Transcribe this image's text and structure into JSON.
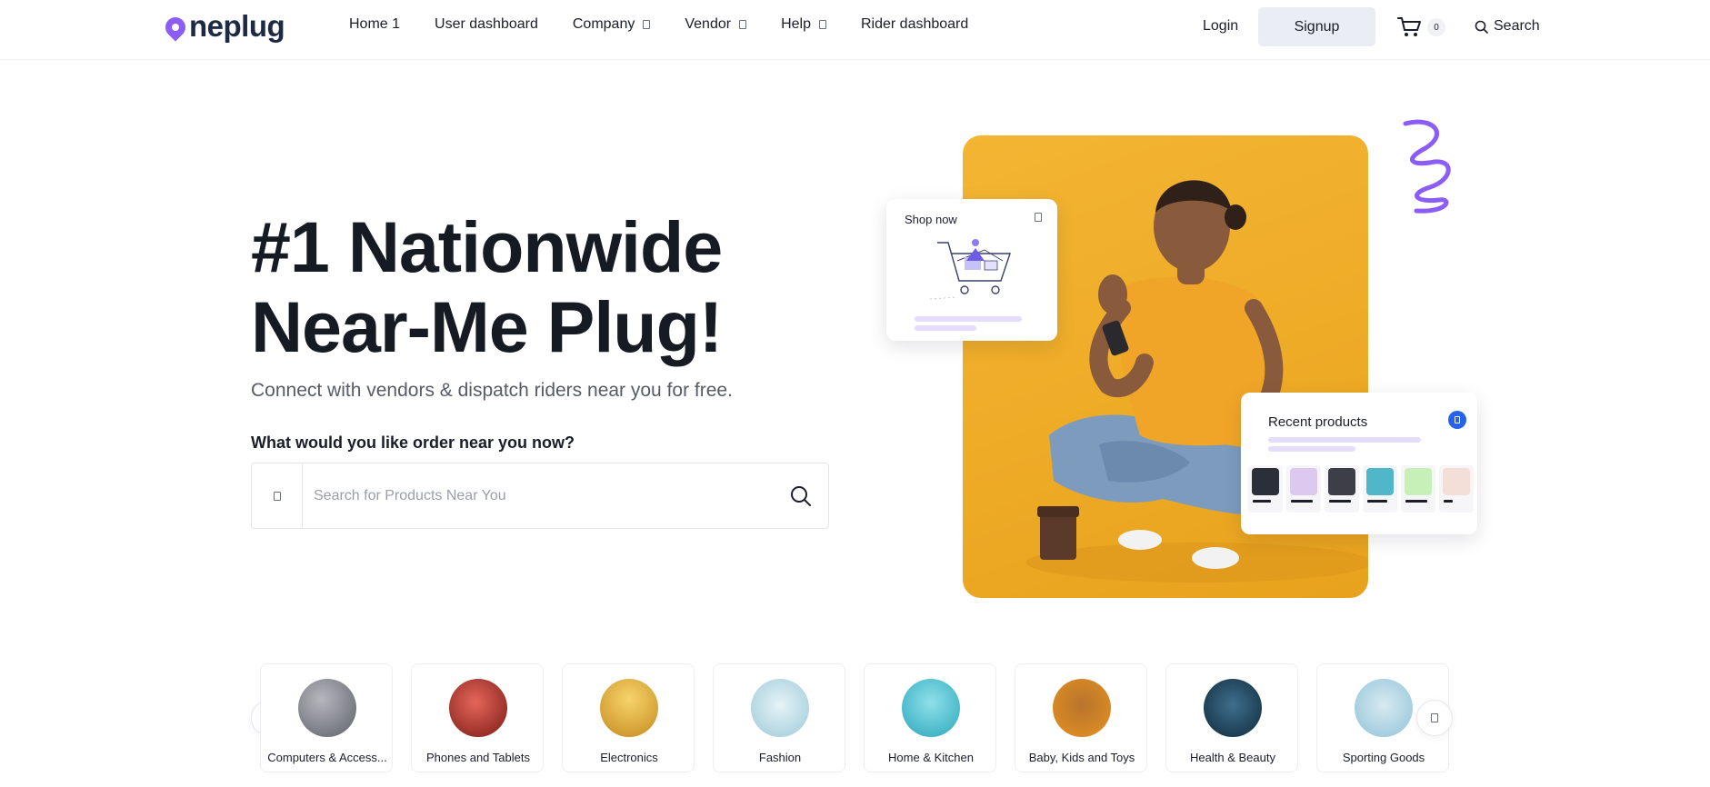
{
  "brand": {
    "name": "neplug",
    "accent": "#8b5cf6"
  },
  "nav": {
    "items": [
      {
        "label": "Home 1",
        "has_dropdown": false
      },
      {
        "label": "User dashboard",
        "has_dropdown": false
      },
      {
        "label": "Company",
        "has_dropdown": true
      },
      {
        "label": "Vendor",
        "has_dropdown": true
      },
      {
        "label": "Help",
        "has_dropdown": true
      },
      {
        "label": "Rider dashboard",
        "has_dropdown": false
      }
    ],
    "login_label": "Login",
    "signup_label": "Signup",
    "cart_count": "0",
    "search_label": "Search"
  },
  "hero": {
    "title_line1": "#1 Nationwide",
    "title_line2": "Near-Me Plug!",
    "subtitle": "Connect with vendors & dispatch riders near you for free.",
    "question": "What would you like order near you now?",
    "search_placeholder": "Search for Products Near You"
  },
  "cards": {
    "shop_now": "Shop now",
    "recent_products": "Recent products"
  },
  "categories": [
    {
      "label": "Computers & Access...",
      "icon": "laptop-icon"
    },
    {
      "label": "Phones and Tablets",
      "icon": "phone-icon"
    },
    {
      "label": "Electronics",
      "icon": "electronics-icon"
    },
    {
      "label": "Fashion",
      "icon": "shoe-icon"
    },
    {
      "label": "Home & Kitchen",
      "icon": "appliance-icon"
    },
    {
      "label": "Baby, Kids and Toys",
      "icon": "teddy-bear-icon"
    },
    {
      "label": "Health & Beauty",
      "icon": "cosmetics-icon"
    },
    {
      "label": "Sporting Goods",
      "icon": "ball-icon"
    }
  ]
}
